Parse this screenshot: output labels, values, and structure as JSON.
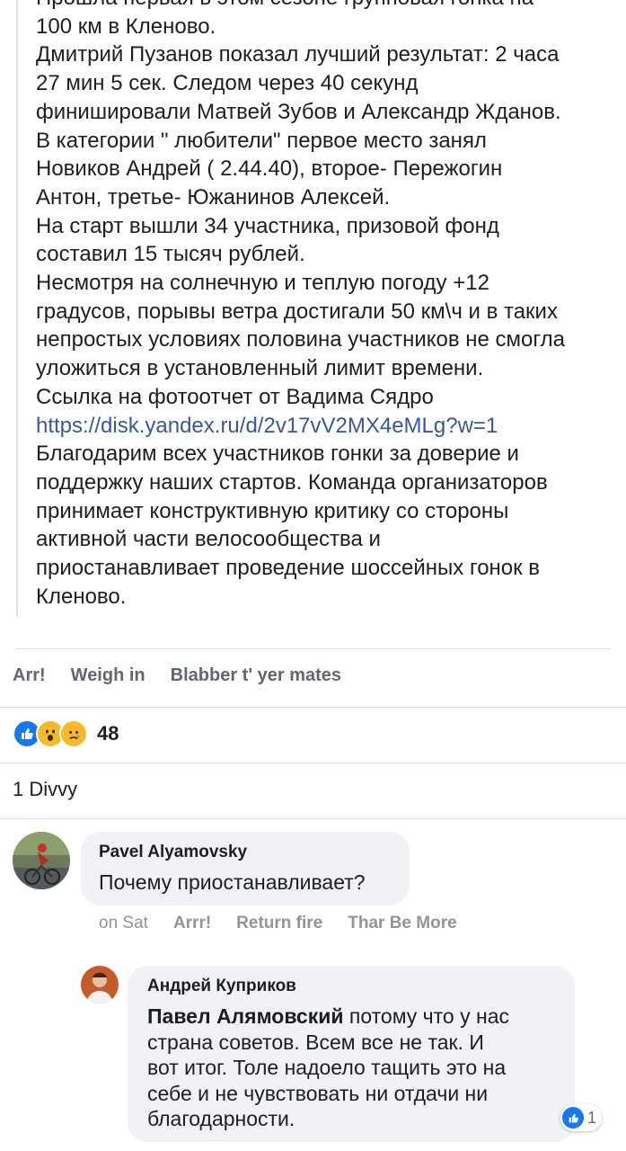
{
  "post": {
    "lines": [
      "Прошла первая в этом сезоне групповая гонка на",
      "100 км в Кленово.",
      "Дмитрий Пузанов показал лучший результат: 2 часа",
      "27 мин 5 сек. Следом через 40 секунд",
      "финишировали Матвей Зубов и Александр Жданов.",
      "В категории \" любители\" первое место занял",
      "Новиков Андрей ( 2.44.40), второе- Пережогин",
      "Антон, третье- Южанинов Алексей.",
      "На старт вышли 34 участника, призовой фонд",
      "составил 15 тысяч рублей.",
      "Несмотря на солнечную и теплую погоду +12",
      "градусов, порывы ветра достигали 50 км\\ч и в таких",
      "непростых условиях половина участников не смогла",
      "уложиться в установленный лимит времени.",
      "Ссылка на фотоотчет от Вадима Сядро"
    ],
    "link": "https://disk.yandex.ru/d/2v17vV2MX4eMLg?w=1",
    "lines_after": [
      "Благодарим всех участников гонки за доверие и",
      "поддержку наших стартов. Команда организаторов",
      "принимает конструктивную критику со стороны",
      "активной части велосообщества и",
      "приостанавливает проведение шоссейных гонок в",
      "Кленово."
    ]
  },
  "actions": {
    "like": "Arr!",
    "comment": "Weigh in",
    "share": "Blabber t' yer mates"
  },
  "reactions": {
    "icons": [
      "like-icon",
      "wow-icon",
      "sad-icon"
    ],
    "count": "48"
  },
  "shares": "1 Divvy",
  "comments": [
    {
      "author": "Pavel Alyamovsky",
      "text": "Почему приостанавливает?",
      "time": "on Sat",
      "like": "Arrr!",
      "reply": "Return fire",
      "more": "Thar Be More"
    }
  ],
  "reply": {
    "author": "Андрей Куприков",
    "mention": "Павел Алямовский",
    "line1": " потому что у нас",
    "line2": "страна советов. Всем все не так. И",
    "line3": "вот итог. Толе надоело тащить это на",
    "line4": "себе и не чувствовать ни отдачи ни",
    "line5": "благодарности.",
    "like_count": "1"
  },
  "colors": {
    "link": "#385898",
    "like_blue": "#1877f2",
    "bubble": "#f0f2f5",
    "muted": "#606770"
  }
}
